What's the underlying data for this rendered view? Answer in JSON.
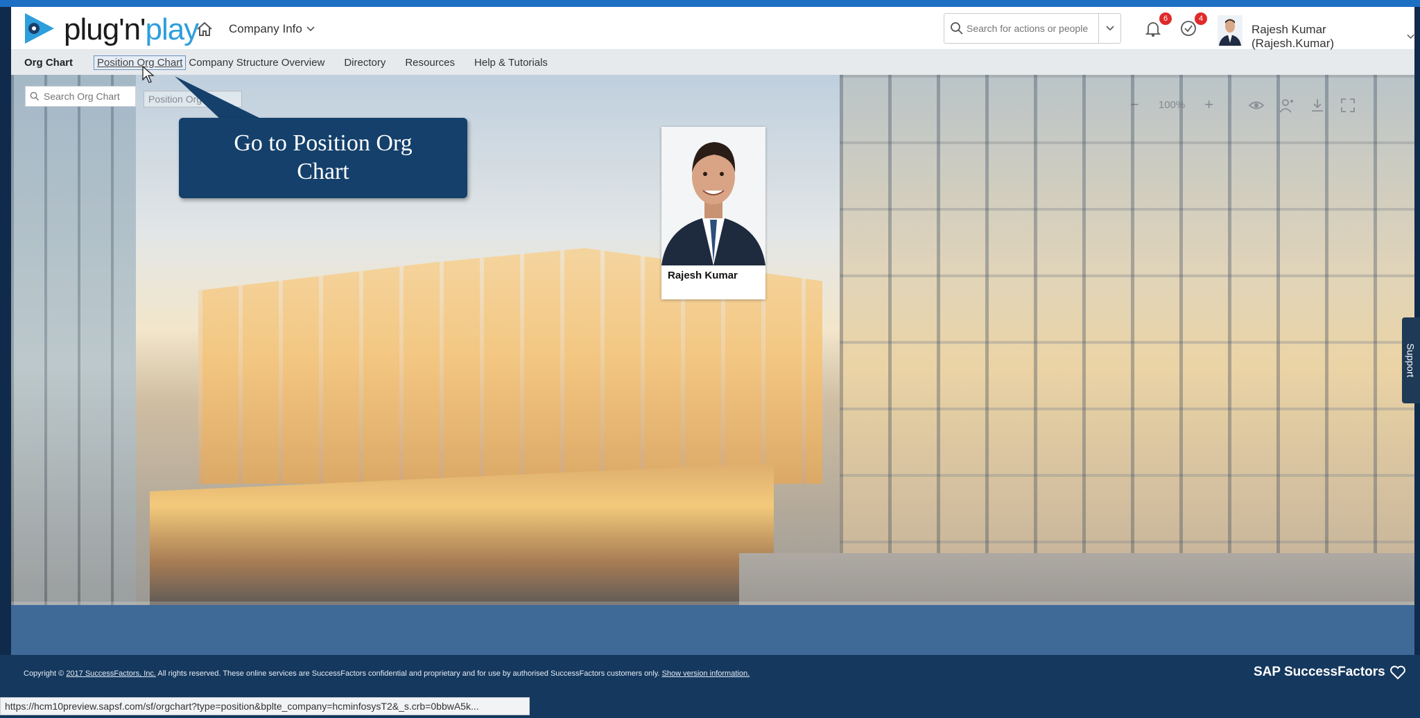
{
  "app": {
    "logo_text_a": "plug'n'",
    "logo_text_b": "play"
  },
  "header": {
    "company_menu": "Company Info",
    "search_placeholder": "Search for actions or people",
    "notifications_count": "6",
    "todo_count": "4",
    "user_name": "Rajesh Kumar (Rajesh.Kumar)"
  },
  "subnav": {
    "items": [
      "Org Chart",
      "Position Org Chart",
      "Company Structure Overview",
      "Directory",
      "Resources",
      "Help & Tutorials"
    ]
  },
  "orgchart": {
    "search_placeholder": "Search Org Chart",
    "position_chip": "Position Org",
    "zoom": "100%",
    "zoom_out": "−",
    "zoom_in": "+",
    "card_name": "Rajesh Kumar"
  },
  "callout": {
    "text": "Go to Position Org Chart"
  },
  "support": {
    "label": "Support"
  },
  "footer": {
    "copyright_prefix": "Copyright ©",
    "copyright_link": "2017 SuccessFactors, Inc.",
    "copyright_body": " All rights reserved. These online services are SuccessFactors confidential and proprietary and for use by authorised SuccessFactors customers only.",
    "version_link": "Show version information.",
    "brand": "SAP SuccessFactors"
  },
  "statusbar": {
    "url": "https://hcm10preview.sapsf.com/sf/orgchart?type=position&bplte_company=hcminfosysT2&_s.crb=0bbwA5k..."
  },
  "colors": {
    "accent": "#1d6fc4",
    "callout_bg": "#14406b",
    "footer_bg": "#15385e",
    "badge": "#e02a2a"
  }
}
